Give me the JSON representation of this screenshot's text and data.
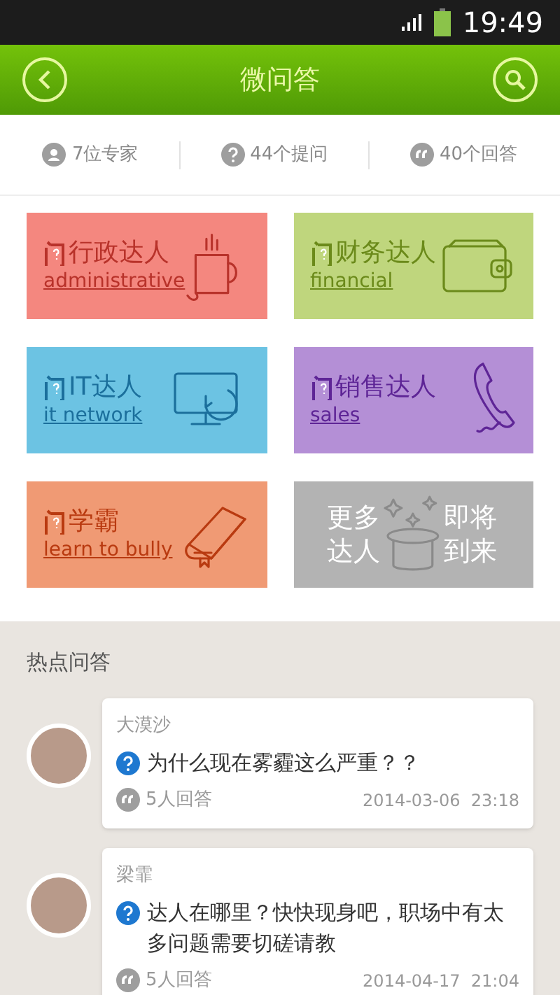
{
  "status_bar": {
    "time": "19:49"
  },
  "header": {
    "title": "微问答"
  },
  "stats": [
    {
      "kind": "experts",
      "text": "7位专家"
    },
    {
      "kind": "questions",
      "text": "44个提问"
    },
    {
      "kind": "answers",
      "text": "40个回答"
    }
  ],
  "categories": [
    {
      "kind": "category",
      "title": "行政达人",
      "subtitle": "administrative",
      "color": "#f4877f"
    },
    {
      "kind": "category",
      "title": "财务达人",
      "subtitle": "financial",
      "color": "#bfd67d"
    },
    {
      "kind": "category",
      "title": "IT达人",
      "subtitle": "it network",
      "color": "#6cc3e3"
    },
    {
      "kind": "category",
      "title": "销售达人",
      "subtitle": "sales",
      "color": "#b48fd6"
    },
    {
      "kind": "category",
      "title": "学霸",
      "subtitle": "learn to bully",
      "color": "#f09a74"
    },
    {
      "kind": "coming_soon",
      "left": "更多达人",
      "right": "即将到来",
      "color": "#b3b3b3"
    }
  ],
  "hot": {
    "title": "热点问答",
    "items": [
      {
        "user": "大漠沙",
        "question": "为什么现在雾霾这么严重？？",
        "answers": "5人回答",
        "date": "2014-03-06  23:18"
      },
      {
        "user": "梁霏",
        "question": "达人在哪里？快快现身吧，职场中有太多问题需要切磋请教",
        "answers": "5人回答",
        "date": "2014-04-17  21:04"
      }
    ]
  }
}
